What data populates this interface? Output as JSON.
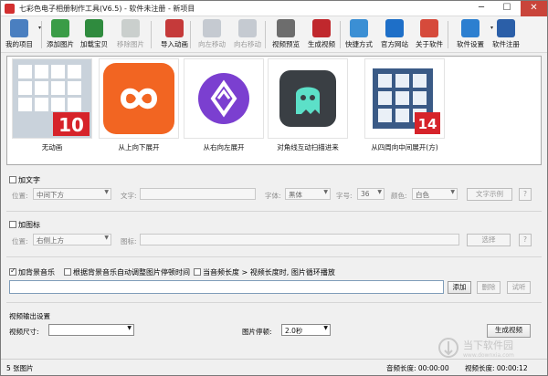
{
  "window": {
    "title": "七彩色电子相册制作工具(V6.5) - 软件未注册 - 新项目",
    "min": "─",
    "max": "☐",
    "close": "✕"
  },
  "toolbar": [
    {
      "id": "my-project",
      "label": "我的项目",
      "color": "#4a7fc0",
      "enabled": true,
      "caret": true
    },
    {
      "id": "add-image",
      "label": "添加图片",
      "color": "#3a9c47",
      "enabled": true
    },
    {
      "id": "load-album",
      "label": "加载宝贝",
      "color": "#2f8b3e",
      "enabled": true
    },
    {
      "id": "remove-image",
      "label": "移除图片",
      "color": "#9aa4a0",
      "enabled": false
    },
    {
      "id": "import-animation",
      "label": "导入动画",
      "color": "#c53a3a",
      "enabled": true
    },
    {
      "id": "move-left",
      "label": "向左移动",
      "color": "#8e9aa8",
      "enabled": false
    },
    {
      "id": "move-right",
      "label": "向右移动",
      "color": "#8e9aa8",
      "enabled": false
    },
    {
      "id": "video-preview",
      "label": "视频预览",
      "color": "#6d6d6d",
      "enabled": true
    },
    {
      "id": "generate-video",
      "label": "生成视频",
      "color": "#c0282d",
      "enabled": true
    },
    {
      "id": "shortcuts",
      "label": "快捷方式",
      "color": "#3b8fd4",
      "enabled": true
    },
    {
      "id": "official-site",
      "label": "官方网站",
      "color": "#1e6fc8",
      "enabled": true
    },
    {
      "id": "about",
      "label": "关于软件",
      "color": "#d64a3b",
      "enabled": true
    },
    {
      "id": "software-settings",
      "label": "软件设置",
      "color": "#2c7fd0",
      "enabled": true,
      "caret": true
    },
    {
      "id": "register",
      "label": "软件注册",
      "color": "#2b5fa8",
      "enabled": true
    }
  ],
  "thumbnails": [
    {
      "caption": "无动画",
      "badge": "10",
      "bg": "#c6cfd8"
    },
    {
      "caption": "从上向下展开",
      "bg": "#f26522"
    },
    {
      "caption": "从右向左展开",
      "bg": "#ffffff"
    },
    {
      "caption": "对角线互动扫描进来",
      "bg": "#ffffff"
    },
    {
      "caption": "从四周向中间展开(方)",
      "badge": "14",
      "bg": "#ffffff"
    }
  ],
  "text_section": {
    "title": "加文字",
    "position_label": "位置:",
    "position_value": "中间下方",
    "text_label": "文字:",
    "font_label": "字体:",
    "font_value": "黑体",
    "size_label": "字号:",
    "size_value": "36",
    "color_label": "颜色:",
    "color_value": "白色",
    "sample_btn": "文字示例",
    "help": "?"
  },
  "icon_section": {
    "title": "加图标",
    "position_label": "位置:",
    "position_value": "右侧上方",
    "icon_label": "图标:",
    "select_btn": "选择",
    "help": "?"
  },
  "music_section": {
    "bg_music": "加背景音乐",
    "auto_adjust": "根据背景音乐自动调整图片停顿时间",
    "loop_text": "当音频长度 > 视频长度时, 图片循环播放",
    "add": "添加",
    "delete": "删除",
    "listen": "试听"
  },
  "output": {
    "title": "视频输出设置",
    "size_label": "视频尺寸:",
    "size_value": "",
    "pause_label": "图片停顿:",
    "pause_value": "2.0秒",
    "generate": "生成视频"
  },
  "status": {
    "count": "5 张图片",
    "audio": "音频长度: 00:00:00",
    "video": "视频长度: 00:00:12"
  },
  "watermark": {
    "text": "当下软件园",
    "url": "www.downxia.com"
  }
}
